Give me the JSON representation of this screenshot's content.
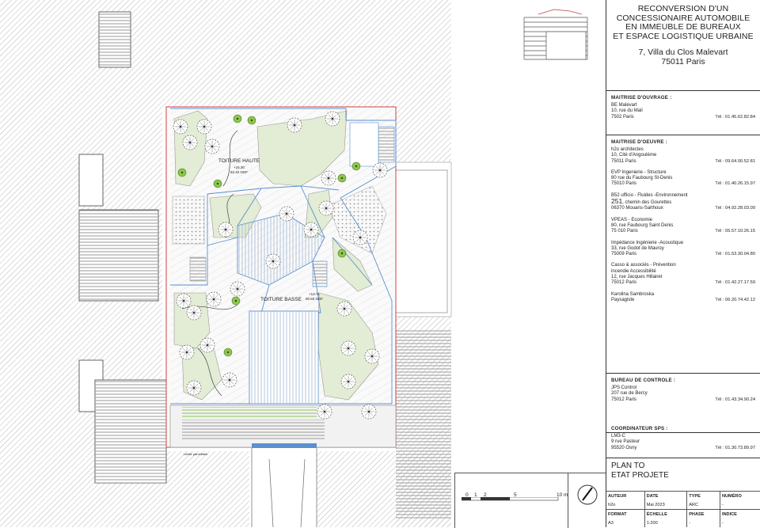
{
  "title_lines": [
    "RECONVERSION D'UN",
    "CONCESSIONAIRE AUTOMOBILE",
    "EN IMMEUBLE DE BUREAUX",
    "ET ESPACE LOGISTIQUE URBAINE"
  ],
  "address_lines": [
    "7, Villa du Clos Malevart",
    "75011 Paris"
  ],
  "owner": {
    "header": "MAITRISE D'OUVRAGE :",
    "name": "BE Malevart",
    "lines": [
      "10, rue du Mail",
      "7502 Paris"
    ],
    "tel": "Tél : 01.45.62.82.84"
  },
  "moe": {
    "header": "MAITRISE D'OEUVRE :",
    "parties": [
      {
        "name": "h2o architectes",
        "lines": [
          "10, Cité d'Angoulème",
          "75011 Paris"
        ],
        "tel": "Tél : 09.64.00.52.81"
      },
      {
        "name": "EVP Ingenierie - Structure",
        "lines": [
          "80 rue du Faubourg St-Denis",
          "75010 Paris"
        ],
        "tel": "Tél : 01.40.26.15.97"
      },
      {
        "name": "B52 ufficio - Fluides -Environnement",
        "big": "251",
        "bigrest": ", chemin des Gourettes",
        "lines": [
          "06370 Mouans-Sarthoux"
        ],
        "tel": "Tél : 04.92.28.03.09"
      },
      {
        "name": "VPEAS - Economie",
        "lines": [
          "80, rue Faubourg Saint Denis",
          "75 010 Paris"
        ],
        "tel": "Tél : 05.57.10.26.15"
      },
      {
        "name": "Impédance Ingénierie -Acoustique",
        "lines": [
          "33, rue Godot de Mauroy",
          "75009 Paris"
        ],
        "tel": "Tél : 01.53.30.04.80"
      },
      {
        "name": "Casso & associés - Prévention",
        "lines": [
          "incendie Accessibilité",
          "12, rue Jacques Hillairet",
          "75012 Paris"
        ],
        "tel": "Tél : 01.42.27.17.59"
      },
      {
        "name": "Karolina Sambroska",
        "lines": [
          "Paysagiste"
        ],
        "tel": "Tél : 06.20.74.42.12"
      }
    ]
  },
  "control": {
    "header": "BUREAU DE CONTROLE :",
    "name": "JPS Control",
    "lines": [
      "207 rue de Bercy",
      "75012 Paris"
    ],
    "tel": "Tél : 01.43.34.90.24"
  },
  "sps": {
    "header": "COORDINATEUR SPS :",
    "name": "LM3-C",
    "lines": [
      "9 rue Pasteur",
      "95520 Osny"
    ],
    "tel": "Tél : 01.30.73.89.97"
  },
  "plan_title": [
    "PLAN TO",
    "ETAT PROJETE"
  ],
  "meta": {
    "h1": [
      "AUTEUR",
      "DATE",
      "TYPE",
      "NUMÉRO"
    ],
    "v1": [
      "h2o",
      "Mai 2023",
      "ARC",
      "-"
    ],
    "h2": [
      "FORMAT",
      "ÉCHELLE",
      "PHASE",
      "INDICE"
    ],
    "v2": [
      "A3",
      "1:200",
      "-",
      "-"
    ]
  },
  "scale_labels": [
    "0",
    "1",
    "2",
    "5",
    "10 m"
  ],
  "plan_labels": {
    "roof_high": "TOITURE HAUTE",
    "roof_high_lvl": "+15.30",
    "roof_high_ngf": "62.42 NGF",
    "roof_low": "TOITURE BASSE",
    "roof_low_lvl": "+13.71",
    "roof_low_ngf": "60.83 NGF",
    "limit": "Limite parcellaire"
  },
  "colors": {
    "lawn": "#e4edd5",
    "deck": "#f0f0f0",
    "tree": "#7a7a6a",
    "highlight": "#7fbf3f",
    "water": "#5a90d0",
    "hatch": "#bdbdbd",
    "limit": "#d04040"
  }
}
